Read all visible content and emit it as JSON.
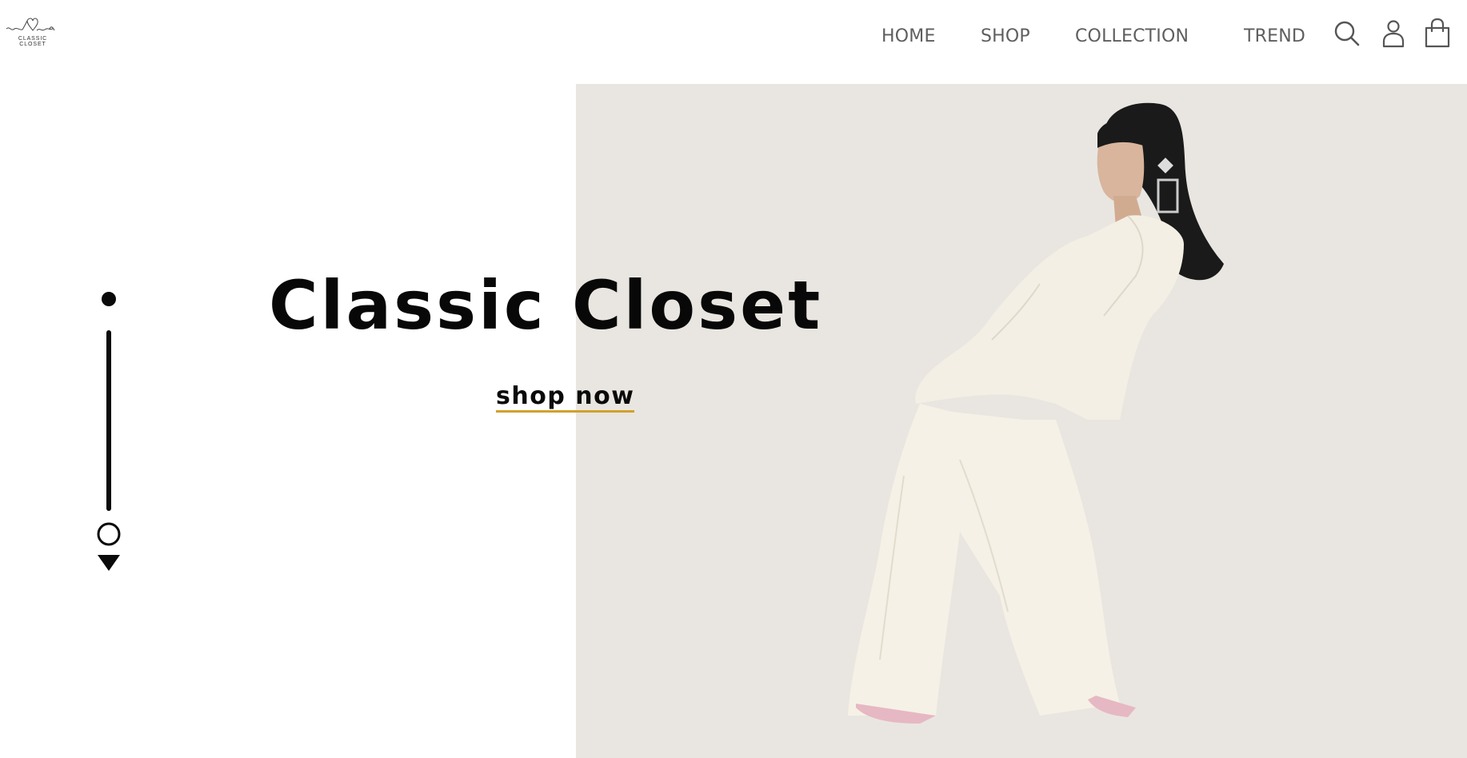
{
  "header": {
    "logo_text": "CLASSIC CLOSET",
    "nav": [
      {
        "label": "HOME"
      },
      {
        "label": "SHOP"
      },
      {
        "label": "COLLECTION"
      },
      {
        "label": "TREND"
      }
    ],
    "icons": [
      "search-icon",
      "user-icon",
      "shopping-bag-icon"
    ]
  },
  "hero": {
    "title": "Classic Closet",
    "cta_label": "shop now",
    "panel_color": "#e9e6e1",
    "cta_underline_color": "#d1a12e"
  },
  "scroll_indicator": {
    "icons": [
      "dot-icon",
      "line",
      "circle-icon",
      "down-arrow-icon"
    ]
  }
}
